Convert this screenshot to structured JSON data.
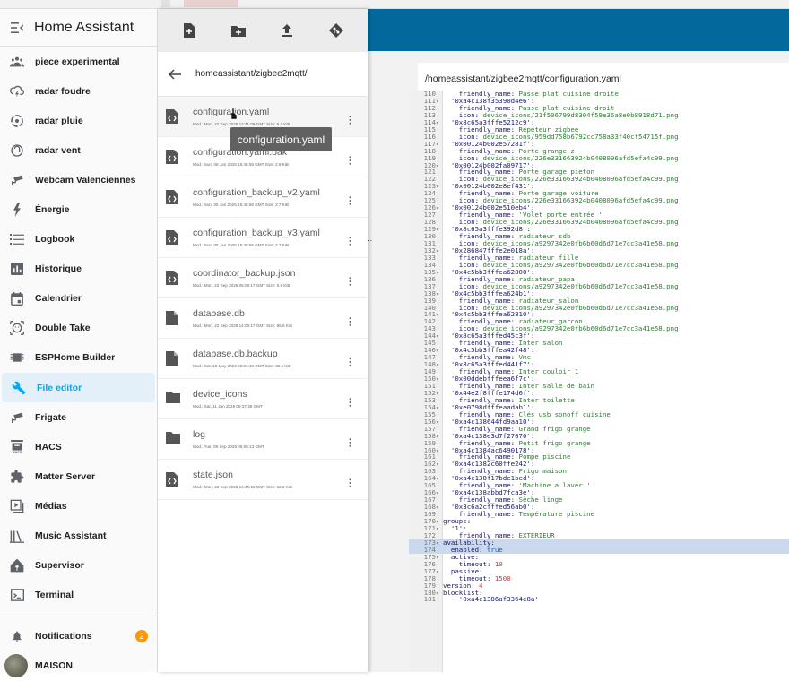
{
  "app": {
    "title": "Home Assistant"
  },
  "sidebar": {
    "items": [
      {
        "label": "piece experimental",
        "icon": "account-group-icon"
      },
      {
        "label": "radar foudre",
        "icon": "weather-lightning-icon"
      },
      {
        "label": "radar pluie",
        "icon": "radar-icon"
      },
      {
        "label": "radar vent",
        "icon": "wind-icon"
      },
      {
        "label": "Webcam Valenciennes",
        "icon": "cctv-icon"
      },
      {
        "label": "Énergie",
        "icon": "lightning-bolt-icon"
      },
      {
        "label": "Logbook",
        "icon": "list-icon"
      },
      {
        "label": "Historique",
        "icon": "chart-box-icon"
      },
      {
        "label": "Calendrier",
        "icon": "calendar-icon"
      },
      {
        "label": "Double Take",
        "icon": "face-recognition-icon"
      },
      {
        "label": "ESPHome Builder",
        "icon": "chip-icon"
      },
      {
        "label": "File editor",
        "icon": "wrench-icon",
        "active": true
      },
      {
        "label": "Frigate",
        "icon": "cctv-icon"
      },
      {
        "label": "HACS",
        "icon": "hacs-icon"
      },
      {
        "label": "Matter Server",
        "icon": "puzzle-icon"
      },
      {
        "label": "Médias",
        "icon": "play-box-icon"
      },
      {
        "label": "Music Assistant",
        "icon": "library-music-icon"
      },
      {
        "label": "Supervisor",
        "icon": "home-assistant-icon"
      },
      {
        "label": "Terminal",
        "icon": "console-icon"
      }
    ],
    "notifications": {
      "label": "Notifications",
      "count": "2"
    },
    "user": {
      "label": "MAISON"
    }
  },
  "file_browser": {
    "current_path": "homeassistant/zigbee2mqtt/",
    "files": [
      {
        "name": "configuration.yaml",
        "meta": "Mod.: Mon, 22 Sep 2025 13:41:09 GMT  Size: 5.3 KiB",
        "type": "code"
      },
      {
        "name": "configuration.yaml.bak",
        "meta": "Mod.: Sun, 05 Jan 2025 15:48:55 GMT  Size: 2.9 KiB",
        "type": "code"
      },
      {
        "name": "configuration_backup_v2.yaml",
        "meta": "Mod.: Sun, 05 Jan 2025 15:48:55 GMT  Size: 2.7 KiB",
        "type": "code"
      },
      {
        "name": "configuration_backup_v3.yaml",
        "meta": "Mod.: Sun, 05 Jan 2025 15:48:55 GMT  Size: 2.7 KiB",
        "type": "code"
      },
      {
        "name": "coordinator_backup.json",
        "meta": "Mod.: Mon, 22 Sep 2025 05:08:17 GMT  Size: 0.8 KiB",
        "type": "code"
      },
      {
        "name": "database.db",
        "meta": "Mod.: Mon, 22 Sep 2025 14:06:17 GMT  Size: 65.6 KiB",
        "type": "file"
      },
      {
        "name": "database.db.backup",
        "meta": "Mod.: Sat, 18 May 2024 09:21:10 GMT  Size: 36.5 KiB",
        "type": "file"
      },
      {
        "name": "device_icons",
        "meta": "Mod.: Sat, 11 Jan 2025 09:37:39 GMT",
        "type": "folder"
      },
      {
        "name": "log",
        "meta": "Mod.: Tue, 09 Sep 2025 05:06:13 GMT",
        "type": "folder"
      },
      {
        "name": "state.json",
        "meta": "Mod.: Mon, 22 Sep 2025 14:46:18 GMT  Size: 12.2 KiB",
        "type": "code"
      }
    ],
    "tooltip": "configuration.yaml"
  },
  "editor": {
    "path": "/homeassistant/zigbee2mqtt/configuration.yaml",
    "background_fragment": "uv...",
    "lines": [
      {
        "n": "110",
        "f": "",
        "t": "    friendly_name: Passe plat cuisine droite"
      },
      {
        "n": "111",
        "f": "▾",
        "t": "  '0xa4c138f35390d4e6':"
      },
      {
        "n": "112",
        "f": "",
        "t": "    friendly_name: Passe plat cuisine droit"
      },
      {
        "n": "113",
        "f": "",
        "t": "    icon: device_icons/21f506799d8304f59e36a8e0b8918d71.png"
      },
      {
        "n": "114",
        "f": "▾",
        "t": "  '0x8c65a3fffe5212c9':"
      },
      {
        "n": "115",
        "f": "",
        "t": "    friendly_name: Répéteur zigbee"
      },
      {
        "n": "116",
        "f": "",
        "t": "    icon: device_icons/959dd758b6792cc758a33f40cf54715f.png"
      },
      {
        "n": "117",
        "f": "▾",
        "t": "  '0x00124b002e57281f':"
      },
      {
        "n": "118",
        "f": "",
        "t": "    friendly_name: Porte grange z"
      },
      {
        "n": "119",
        "f": "",
        "t": "    icon: device_icons/226e331663924b0408096afd5efa4c99.png"
      },
      {
        "n": "120",
        "f": "▾",
        "t": "  '0x00124b002fa09717':"
      },
      {
        "n": "121",
        "f": "",
        "t": "    friendly_name: Porte garage pieton"
      },
      {
        "n": "122",
        "f": "",
        "t": "    icon: device_icons/226e331663924b0408096afd5efa4c99.png"
      },
      {
        "n": "123",
        "f": "▾",
        "t": "  '0x00124b002e8ef431':"
      },
      {
        "n": "124",
        "f": "",
        "t": "    friendly_name: Porte garage voiture"
      },
      {
        "n": "125",
        "f": "",
        "t": "    icon: device_icons/226e331663924b0408096afd5efa4c99.png"
      },
      {
        "n": "126",
        "f": "▾",
        "t": "  '0x00124b002e510eb4':"
      },
      {
        "n": "127",
        "f": "",
        "t": "    friendly_name: 'Volet porte entrée '"
      },
      {
        "n": "128",
        "f": "",
        "t": "    icon: device_icons/226e331663924b0408096afd5efa4c99.png"
      },
      {
        "n": "129",
        "f": "▾",
        "t": "  '0x8c65a3fffe392d8':"
      },
      {
        "n": "130",
        "f": "",
        "t": "    friendly_name: radiateur sdb"
      },
      {
        "n": "131",
        "f": "",
        "t": "    icon: device_icons/a9297342e0fb6b60d6d71e7cc3a41e58.png"
      },
      {
        "n": "132",
        "f": "▾",
        "t": "  '0x286847fffe2e018a':"
      },
      {
        "n": "133",
        "f": "",
        "t": "    friendly_name: radiateur fille"
      },
      {
        "n": "134",
        "f": "",
        "t": "    icon: device_icons/a9297342e0fb6b60d6d71e7cc3a41e58.png"
      },
      {
        "n": "135",
        "f": "▾",
        "t": "  '0x4c5bb3fffea62800':"
      },
      {
        "n": "136",
        "f": "",
        "t": "    friendly_name: radiateur_papa"
      },
      {
        "n": "137",
        "f": "",
        "t": "    icon: device_icons/a9297342e0fb6b60d6d71e7cc3a41e58.png"
      },
      {
        "n": "138",
        "f": "▾",
        "t": "  '0x4c5bb3fffea624b1':"
      },
      {
        "n": "139",
        "f": "",
        "t": "    friendly_name: radiateur_salon"
      },
      {
        "n": "140",
        "f": "",
        "t": "    icon: device_icons/a9297342e0fb6b60d6d71e7cc3a41e58.png"
      },
      {
        "n": "141",
        "f": "▾",
        "t": "  '0x4c5bb3fffea62810':"
      },
      {
        "n": "142",
        "f": "",
        "t": "    friendly_name: radiateur_garcon"
      },
      {
        "n": "143",
        "f": "",
        "t": "    icon: device_icons/a9297342e0fb6b60d6d71e7cc3a41e58.png"
      },
      {
        "n": "144",
        "f": "▾",
        "t": "  '0x8c65a3fffed45c3f':"
      },
      {
        "n": "145",
        "f": "",
        "t": "    friendly_name: Inter salon"
      },
      {
        "n": "146",
        "f": "▾",
        "t": "  '0x4c5bb3fffea42f48':"
      },
      {
        "n": "147",
        "f": "",
        "t": "    friendly_name: Vmc"
      },
      {
        "n": "148",
        "f": "▾",
        "t": "  '0x8c65a3fffed441f7':"
      },
      {
        "n": "149",
        "f": "",
        "t": "    friendly_name: Inter couloir 1"
      },
      {
        "n": "150",
        "f": "▾",
        "t": "  '0x00ddebfffeea6f7c':"
      },
      {
        "n": "151",
        "f": "",
        "t": "    friendly_name: Inter salle de bain"
      },
      {
        "n": "152",
        "f": "▾",
        "t": "  '0x44e2f8fffe174d6f':"
      },
      {
        "n": "153",
        "f": "",
        "t": "    friendly_name: Inter toilette"
      },
      {
        "n": "154",
        "f": "▾",
        "t": "  '0xe0798dfffeaadab1':"
      },
      {
        "n": "155",
        "f": "",
        "t": "    friendly_name: Clés usb sonoff cuisine"
      },
      {
        "n": "156",
        "f": "▾",
        "t": "  '0xa4c138644fd9aa10':"
      },
      {
        "n": "157",
        "f": "",
        "t": "    friendly_name: Grand frigo grange"
      },
      {
        "n": "158",
        "f": "▾",
        "t": "  '0xa4c138e3d7f27070':"
      },
      {
        "n": "159",
        "f": "",
        "t": "    friendly_name: Petit frigo grange"
      },
      {
        "n": "160",
        "f": "▾",
        "t": "  '0xa4c1384ac6490178':"
      },
      {
        "n": "161",
        "f": "",
        "t": "    friendly_name: Pompe piscine"
      },
      {
        "n": "162",
        "f": "▾",
        "t": "  '0xa4c1382c60ffe242':"
      },
      {
        "n": "163",
        "f": "",
        "t": "    friendly_name: Frigo maison"
      },
      {
        "n": "164",
        "f": "▾",
        "t": "  '0xa4c138f17bde1bed':"
      },
      {
        "n": "165",
        "f": "",
        "t": "    friendly_name: 'Machine a laver '"
      },
      {
        "n": "166",
        "f": "▾",
        "t": "  '0xa4c138abbd7fca3e':"
      },
      {
        "n": "167",
        "f": "",
        "t": "    friendly_name: Sèche linge"
      },
      {
        "n": "168",
        "f": "▾",
        "t": "  '0x3c6a2cfffed56ab0':"
      },
      {
        "n": "169",
        "f": "",
        "t": "    friendly_name: Température piscine"
      },
      {
        "n": "170",
        "f": "▾",
        "t": "groups:"
      },
      {
        "n": "171",
        "f": "▾",
        "t": "  '1':"
      },
      {
        "n": "172",
        "f": "",
        "t": "    friendly_name: EXTERIEUR"
      },
      {
        "n": "173",
        "f": "▾",
        "t": "availability:",
        "hl": true
      },
      {
        "n": "174",
        "f": "",
        "t": "  enabled: true",
        "hl": true
      },
      {
        "n": "175",
        "f": "▾",
        "t": "  active:"
      },
      {
        "n": "176",
        "f": "",
        "t": "    timeout: 10"
      },
      {
        "n": "177",
        "f": "▾",
        "t": "  passive:"
      },
      {
        "n": "178",
        "f": "",
        "t": "    timeout: 1500"
      },
      {
        "n": "179",
        "f": "",
        "t": "version: 4"
      },
      {
        "n": "180",
        "f": "▾",
        "t": "blocklist:"
      },
      {
        "n": "181",
        "f": "",
        "t": "  - '0xa4c1386af3364e8a'"
      }
    ]
  },
  "colors": {
    "accent": "#03a9f4",
    "topbar": "#03699c",
    "badge": "#ff9800"
  }
}
